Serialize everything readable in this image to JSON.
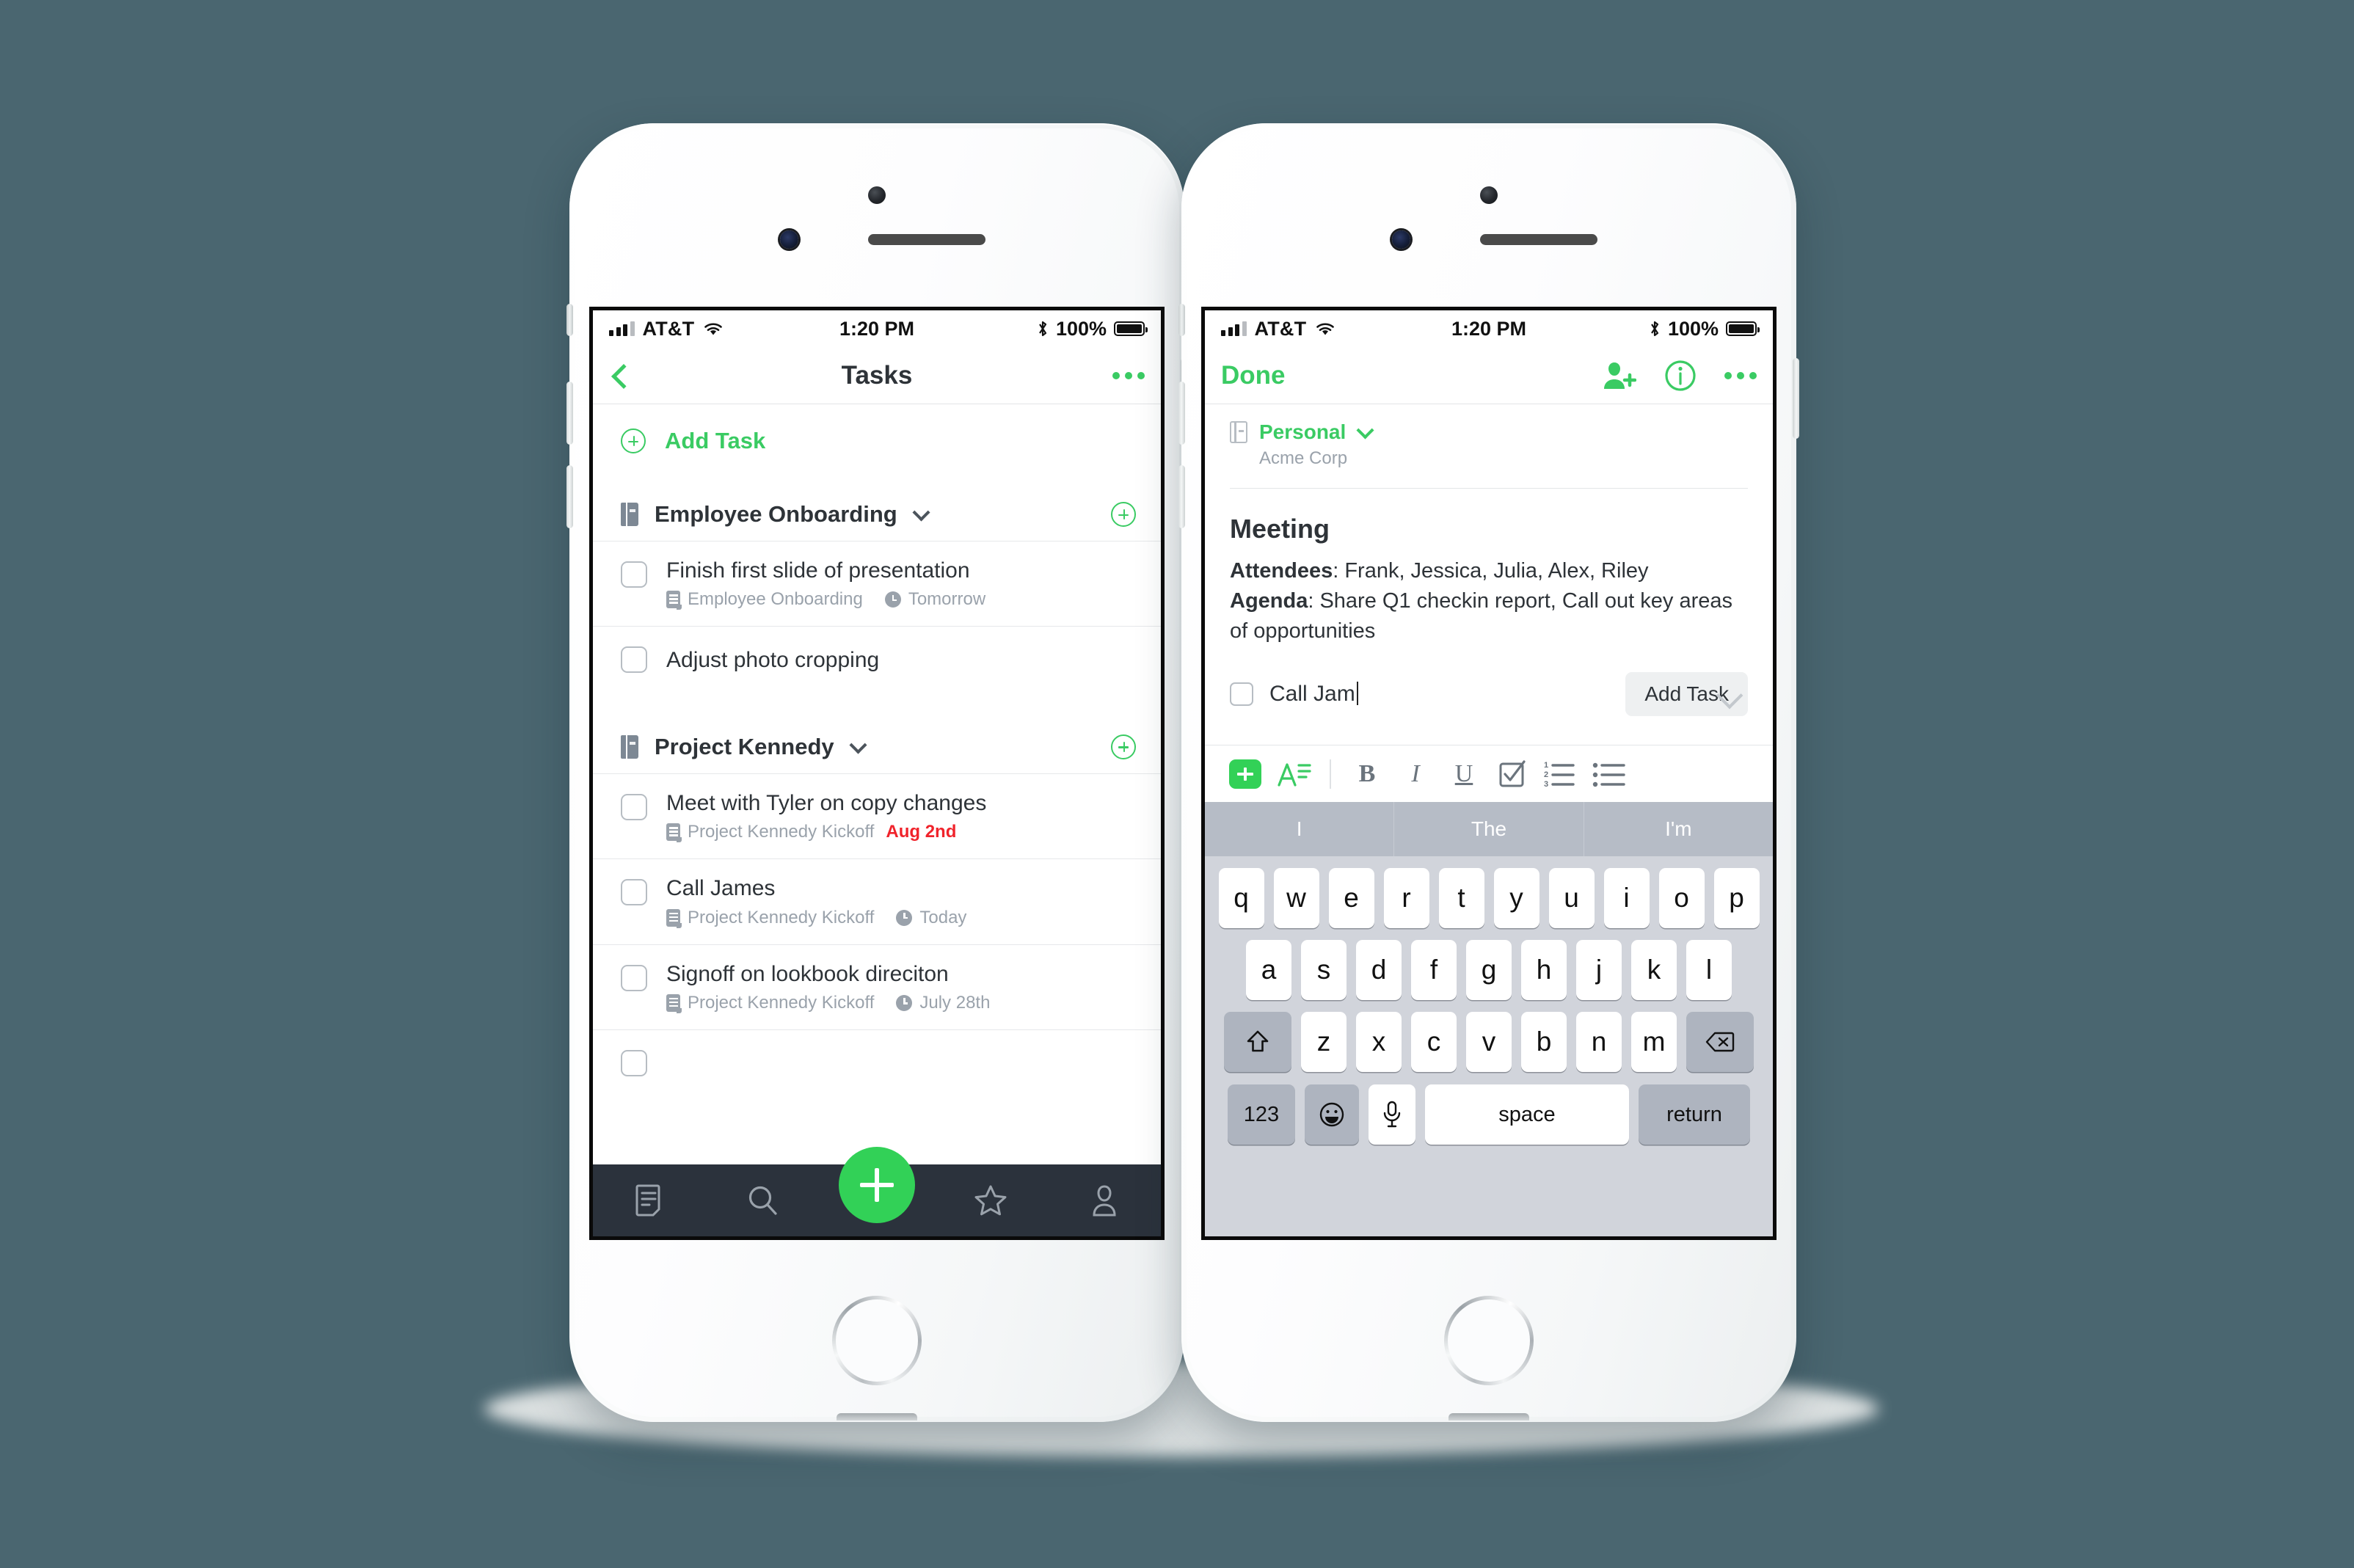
{
  "theme": {
    "background": "#4A6670",
    "accent_green": "#3ACB63",
    "fab_green": "#32D157",
    "tabbar_dark": "#2B323C",
    "overdue_red": "#F0232B",
    "meta_gray": "#9AA2AB"
  },
  "status_bar": {
    "carrier": "AT&T",
    "time": "1:20 PM",
    "battery_percent": "100%"
  },
  "left_phone": {
    "nav": {
      "back_icon": "chevron-left-icon",
      "title": "Tasks",
      "more_icon": "more-horizontal-icon"
    },
    "add_task": {
      "label": "Add Task",
      "icon": "circle-plus-icon"
    },
    "sections": [
      {
        "title": "Employee Onboarding",
        "icon": "notebook-icon",
        "chevron": "chevron-down-icon",
        "add_icon": "circle-plus-icon",
        "tasks": [
          {
            "title": "Finish first slide of presentation",
            "note": "Employee Onboarding",
            "due": "Tomorrow",
            "due_overdue": false,
            "has_clock": true,
            "checked": false
          },
          {
            "title": "Adjust photo cropping",
            "note": "",
            "due": "",
            "due_overdue": false,
            "has_clock": false,
            "checked": false
          }
        ]
      },
      {
        "title": "Project Kennedy",
        "icon": "notebook-icon",
        "chevron": "chevron-down-icon",
        "add_icon": "circle-plus-icon",
        "tasks": [
          {
            "title": "Meet with Tyler on copy changes",
            "note": "Project Kennedy Kickoff",
            "due": "Aug 2nd",
            "due_overdue": true,
            "has_clock": false,
            "checked": false
          },
          {
            "title": "Call James",
            "note": "Project Kennedy Kickoff",
            "due": "Today",
            "due_overdue": false,
            "has_clock": true,
            "checked": false
          },
          {
            "title": "Signoff on lookbook direciton",
            "note": "Project Kennedy Kickoff",
            "due": "July 28th",
            "due_overdue": false,
            "has_clock": true,
            "checked": false
          }
        ]
      }
    ],
    "tabbar": {
      "items": [
        {
          "name": "notes-tab",
          "icon": "note-icon"
        },
        {
          "name": "search-tab",
          "icon": "search-icon"
        },
        {
          "name": "create-fab",
          "icon": "plus-icon"
        },
        {
          "name": "shortcuts-tab",
          "icon": "star-icon"
        },
        {
          "name": "account-tab",
          "icon": "person-icon"
        }
      ]
    }
  },
  "right_phone": {
    "nav": {
      "done_label": "Done",
      "share_icon": "person-add-icon",
      "info_icon": "info-circle-icon",
      "more_icon": "more-horizontal-icon"
    },
    "notebook": {
      "icon": "notebook-icon",
      "name": "Personal",
      "chevron": "chevron-down-icon",
      "subtitle": "Acme Corp"
    },
    "note": {
      "title": "Meeting",
      "lines": [
        {
          "label": "Attendees",
          "text": ": Frank, Jessica, Julia, Alex, Riley"
        },
        {
          "label": "Agenda",
          "text": ": Share Q1 checkin report, Call out key areas of opportunities"
        }
      ],
      "inline_task": {
        "text": "Call Jam",
        "checked": false,
        "button_label": "Add Task"
      },
      "collapse_icon": "chevron-down-icon"
    },
    "format_toolbar": {
      "items": [
        {
          "name": "insert-button",
          "icon": "plus-square-icon",
          "label": "+"
        },
        {
          "name": "text-style-button",
          "icon": "text-format-icon",
          "label": "A"
        },
        {
          "name": "bold-button",
          "icon": "bold-icon",
          "label": "B"
        },
        {
          "name": "italic-button",
          "icon": "italic-icon",
          "label": "I"
        },
        {
          "name": "underline-button",
          "icon": "underline-icon",
          "label": "U"
        },
        {
          "name": "checklist-button",
          "icon": "checkbox-icon",
          "label": ""
        },
        {
          "name": "numbered-list-button",
          "icon": "numbered-list-icon",
          "label": ""
        },
        {
          "name": "bulleted-list-button",
          "icon": "bulleted-list-icon",
          "label": ""
        }
      ]
    },
    "keyboard": {
      "predictions": [
        "I",
        "The",
        "I'm"
      ],
      "row1": [
        "q",
        "w",
        "e",
        "r",
        "t",
        "y",
        "u",
        "i",
        "o",
        "p"
      ],
      "row2": [
        "a",
        "s",
        "d",
        "f",
        "g",
        "h",
        "j",
        "k",
        "l"
      ],
      "row3": [
        "z",
        "x",
        "c",
        "v",
        "b",
        "n",
        "m"
      ],
      "shift_icon": "shift-icon",
      "backspace_icon": "backspace-icon",
      "numbers_key": "123",
      "emoji_icon": "emoji-icon",
      "mic_icon": "microphone-icon",
      "space_key": "space",
      "return_key": "return"
    }
  }
}
